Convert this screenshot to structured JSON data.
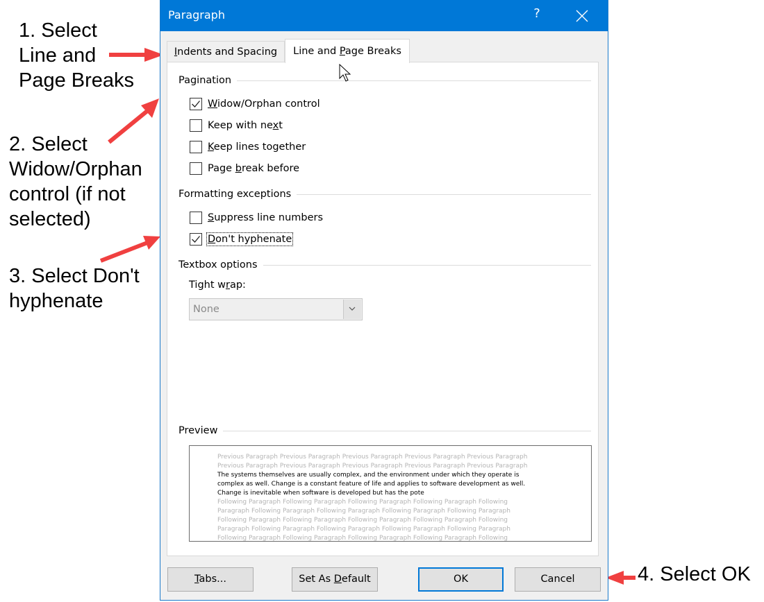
{
  "annotations": {
    "step1": "1. Select\nLine and\nPage Breaks",
    "step2": "2. Select\nWidow/Orphan\ncontrol (if not\nselected)",
    "step3": "3. Select Don't\nhyphenate",
    "step4": "4. Select OK",
    "arrow_color": "#f04040"
  },
  "dialog": {
    "title": "Paragraph",
    "help_label": "?",
    "close_icon": "close-icon",
    "accent_color": "#0078d7",
    "tabs": [
      {
        "label_pre": "",
        "label_mnemonic": "I",
        "label_post": "ndents and Spacing",
        "active": false
      },
      {
        "label_pre": "Line and ",
        "label_mnemonic": "P",
        "label_post": "age Breaks",
        "active": true
      }
    ],
    "pagination": {
      "heading": "Pagination",
      "options": [
        {
          "pre": "",
          "mn": "W",
          "post": "idow/Orphan control",
          "checked": true
        },
        {
          "pre": "Keep with ne",
          "mn": "x",
          "post": "t",
          "checked": false
        },
        {
          "pre": "",
          "mn": "K",
          "post": "eep lines together",
          "checked": false
        },
        {
          "pre": "Page ",
          "mn": "b",
          "post": "reak before",
          "checked": false
        }
      ]
    },
    "formatting": {
      "heading": "Formatting exceptions",
      "options": [
        {
          "pre": "",
          "mn": "S",
          "post": "uppress line numbers",
          "checked": false
        },
        {
          "pre": "",
          "mn": "D",
          "post": "on't hyphenate",
          "checked": true,
          "focused": true
        }
      ]
    },
    "textbox": {
      "heading": "Textbox options",
      "tight_wrap_pre": "Tight w",
      "tight_wrap_mn": "r",
      "tight_wrap_post": "ap:",
      "tight_wrap_value": "None",
      "disabled": true
    },
    "preview": {
      "heading": "Preview",
      "previous_lines": [
        "Previous Paragraph Previous Paragraph Previous Paragraph Previous Paragraph Previous Paragraph",
        "Previous Paragraph Previous Paragraph Previous Paragraph Previous Paragraph Previous Paragraph"
      ],
      "sample_lines": [
        "The systems themselves are usually complex, and the environment under which they operate is",
        "complex as well. Change is a constant feature of life and applies to software development as well.",
        "Change is inevitable when software is developed but has the pote"
      ],
      "following_lines": [
        "Following Paragraph Following Paragraph Following Paragraph Following Paragraph Following",
        "Paragraph Following Paragraph Following Paragraph Following Paragraph Following Paragraph",
        "Following Paragraph Following Paragraph Following Paragraph Following Paragraph Following",
        "Paragraph Following Paragraph Following Paragraph Following Paragraph Following Paragraph",
        "Following Paragraph Following Paragraph Following Paragraph Following Paragraph Following"
      ]
    },
    "buttons": {
      "tabs": {
        "pre": "",
        "mn": "T",
        "post": "abs..."
      },
      "set_default": {
        "pre": "Set As ",
        "mn": "D",
        "post": "efault"
      },
      "ok": "OK",
      "cancel": "Cancel"
    }
  }
}
